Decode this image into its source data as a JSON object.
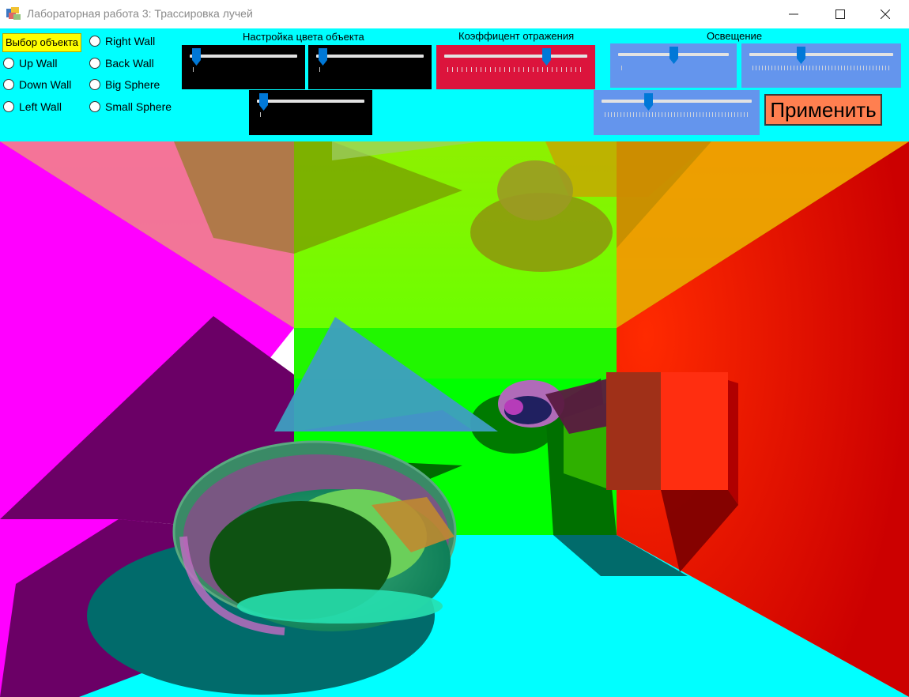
{
  "window": {
    "title": "Лабораторная работа 3: Трассировка лучей",
    "icon": "winforms-app-icon"
  },
  "object_select": {
    "label": "Выбор объекта",
    "options": [
      "Up Wall",
      "Down Wall",
      "Left Wall",
      "Right Wall",
      "Back Wall",
      "Big Sphere",
      "Small Sphere"
    ]
  },
  "color_panel": {
    "title": "Настройка цвета объекта",
    "background": "#000000",
    "sliders": [
      {
        "value_pct": 2
      },
      {
        "value_pct": 2
      },
      {
        "value_pct": 2
      }
    ]
  },
  "reflection_panel": {
    "title": "Коэффицент отражения",
    "background": "#dc143c",
    "slider": {
      "value_pct": 73
    }
  },
  "lighting_panel": {
    "title": "Освещение",
    "background": "#6495ed",
    "sliders": [
      {
        "value_pct": 50
      },
      {
        "value_pct": 35
      },
      {
        "value_pct": 30
      }
    ]
  },
  "apply_button": {
    "label": "Применить",
    "color": "#ff7f50"
  },
  "colors": {
    "panel_bg": "#00ffff",
    "slider_thumb": "#0078d7",
    "label_highlight": "#ffff00"
  },
  "scene": {
    "description": "ray-traced room render",
    "walls": {
      "left": "#ff00ff",
      "right": "#ff0000",
      "up": "#7fff00",
      "back": "#00ff00",
      "down": "#00ffff"
    }
  }
}
